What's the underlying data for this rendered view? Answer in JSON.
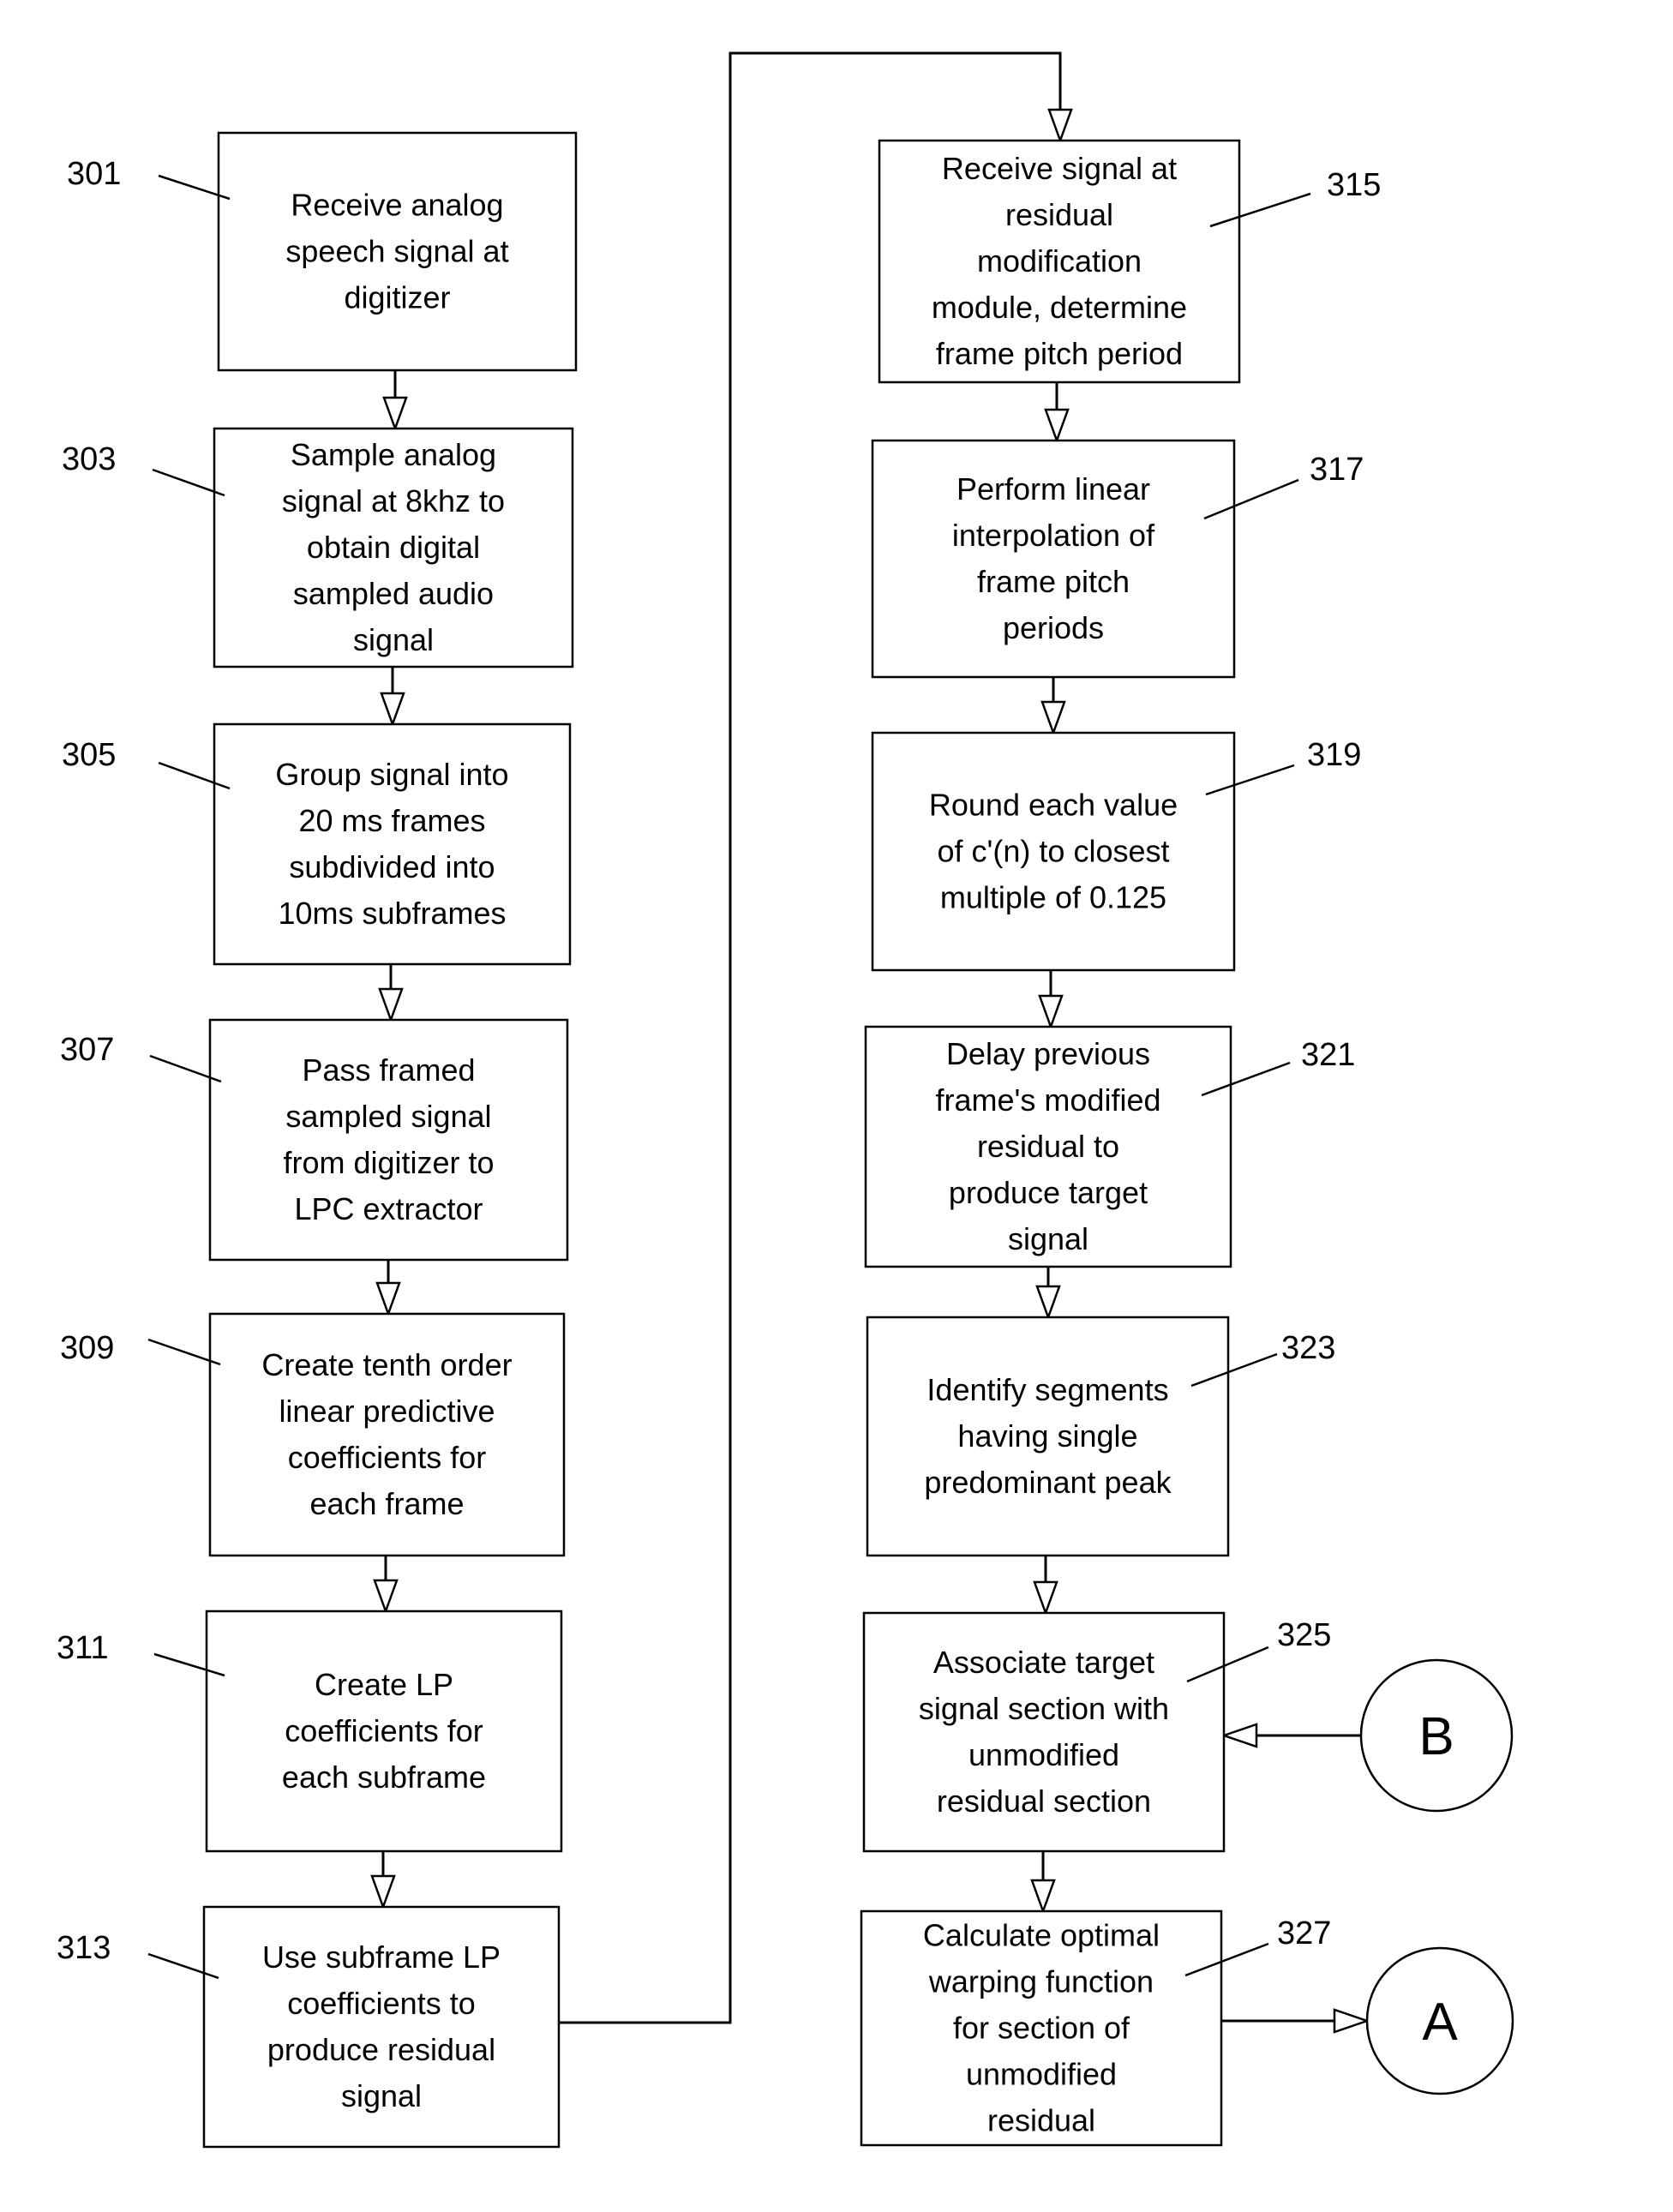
{
  "figure": {
    "steps": [
      {
        "ref": "301",
        "lines": [
          "Receive analog",
          "speech signal at",
          "digitizer"
        ]
      },
      {
        "ref": "303",
        "lines": [
          "Sample analog",
          "signal at 8khz to",
          "obtain digital",
          "sampled audio",
          "signal"
        ]
      },
      {
        "ref": "305",
        "lines": [
          "Group signal into",
          "20 ms frames",
          "subdivided into",
          "10ms subframes"
        ]
      },
      {
        "ref": "307",
        "lines": [
          "Pass framed",
          "sampled signal",
          "from digitizer  to",
          "LPC extractor"
        ]
      },
      {
        "ref": "309",
        "lines": [
          "Create tenth order",
          "linear predictive",
          "coefficients for",
          "each frame"
        ]
      },
      {
        "ref": "311",
        "lines": [
          "Create LP",
          "coefficients for",
          "each subframe"
        ]
      },
      {
        "ref": "313",
        "lines": [
          "Use subframe LP",
          "coefficients to",
          "produce residual",
          "signal"
        ]
      },
      {
        "ref": "315",
        "lines": [
          "Receive signal at",
          "residual",
          "modification",
          "module, determine",
          "frame pitch period"
        ]
      },
      {
        "ref": "317",
        "lines": [
          "Perform linear",
          "interpolation of",
          "frame pitch",
          "periods"
        ]
      },
      {
        "ref": "319",
        "lines": [
          "Round each value",
          "of c'(n) to closest",
          "multiple of 0.125"
        ]
      },
      {
        "ref": "321",
        "lines": [
          "Delay previous",
          "frame's modified",
          "residual to",
          "produce target",
          "signal"
        ]
      },
      {
        "ref": "323",
        "lines": [
          "Identify segments",
          "having single",
          "predominant peak"
        ]
      },
      {
        "ref": "325",
        "lines": [
          "Associate target",
          "signal section with",
          "unmodified",
          "residual section"
        ]
      },
      {
        "ref": "327",
        "lines": [
          "Calculate optimal",
          "warping function",
          "for section of",
          "unmodified",
          "residual"
        ]
      }
    ],
    "connectors": [
      {
        "letter": "B",
        "direction": "incoming",
        "target_ref": "325"
      },
      {
        "letter": "A",
        "direction": "outgoing",
        "source_ref": "327"
      }
    ],
    "colors": {
      "ink": "#000000",
      "paper": "#ffffff"
    }
  }
}
